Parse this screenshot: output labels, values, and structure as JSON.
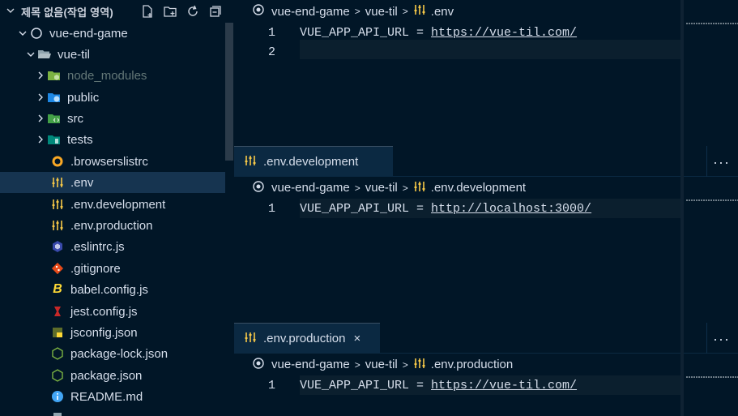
{
  "sidebar": {
    "workspace_title": "제목 없음(작업 영역)",
    "tree": [
      {
        "label": "vue-end-game",
        "icon": "folder-root-icon"
      },
      {
        "label": "vue-til",
        "icon": "folder-open-icon"
      },
      {
        "label": "node_modules",
        "icon": "node-folder-icon"
      },
      {
        "label": "public",
        "icon": "public-folder-icon"
      },
      {
        "label": "src",
        "icon": "src-folder-icon"
      },
      {
        "label": "tests",
        "icon": "tests-folder-icon"
      },
      {
        "label": ".browserslistrc",
        "icon": "browserslist-icon"
      },
      {
        "label": ".env",
        "icon": "env-settings-icon"
      },
      {
        "label": ".env.development",
        "icon": "env-settings-icon"
      },
      {
        "label": ".env.production",
        "icon": "env-settings-icon"
      },
      {
        "label": ".eslintrc.js",
        "icon": "eslint-icon"
      },
      {
        "label": ".gitignore",
        "icon": "git-icon"
      },
      {
        "label": "babel.config.js",
        "icon": "babel-icon"
      },
      {
        "label": "jest.config.js",
        "icon": "jest-icon"
      },
      {
        "label": "jsconfig.json",
        "icon": "js-json-icon"
      },
      {
        "label": "package-lock.json",
        "icon": "nodejs-icon"
      },
      {
        "label": "package.json",
        "icon": "nodejs-icon"
      },
      {
        "label": "README.md",
        "icon": "info-icon"
      }
    ]
  },
  "editors": [
    {
      "breadcrumbs": [
        "vue-end-game",
        "vue-til",
        ".env"
      ],
      "lines": [
        {
          "num": "1",
          "key": "VUE_APP_API_URL = ",
          "url": "https://vue-til.com/"
        },
        {
          "num": "2",
          "key": "",
          "url": ""
        }
      ]
    },
    {
      "tab_label": ".env.development",
      "tab_close": "×",
      "more": "···",
      "breadcrumbs": [
        "vue-end-game",
        "vue-til",
        ".env.development"
      ],
      "lines": [
        {
          "num": "1",
          "key": "VUE_APP_API_URL = ",
          "url": "http://localhost:3000/"
        }
      ]
    },
    {
      "tab_label": ".env.production",
      "tab_close": "×",
      "more": "···",
      "breadcrumbs": [
        "vue-end-game",
        "vue-til",
        ".env.production"
      ],
      "lines": [
        {
          "num": "1",
          "key": "VUE_APP_API_URL = ",
          "url": "https://vue-til.com/"
        }
      ]
    }
  ],
  "colors": {
    "background": "#011627",
    "selection": "#163450",
    "tab_active": "#0b2942",
    "accent_yellow": "#f7c948"
  }
}
